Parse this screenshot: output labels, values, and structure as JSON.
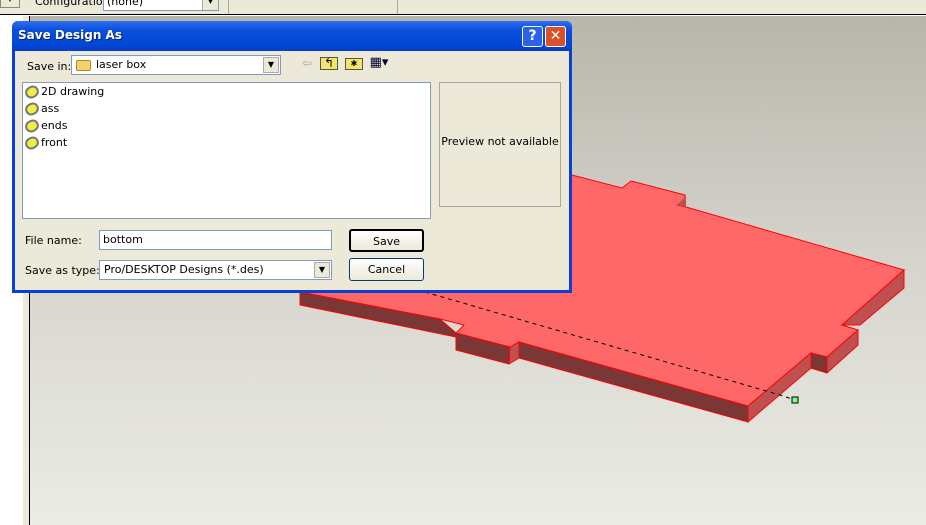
{
  "toolbar": {
    "configuration_label": "Configuration:",
    "configuration_value": "(none)"
  },
  "dialog": {
    "title": "Save Design As",
    "save_in_label": "Save in:",
    "save_in_value": "laser box",
    "files": [
      "2D drawing",
      "ass",
      "ends",
      "front"
    ],
    "preview_text": "Preview not available",
    "file_name_label": "File name:",
    "file_name_value": "bottom",
    "save_as_type_label": "Save as type:",
    "save_as_type_value": "Pro/DESKTOP Designs (*.des)",
    "save_button": "Save",
    "cancel_button": "Cancel",
    "help_button": "?",
    "close_button": "✕"
  },
  "colors": {
    "part_top": "#ff6868",
    "part_side": "#7b3636",
    "titlebar": "#0047d6"
  }
}
